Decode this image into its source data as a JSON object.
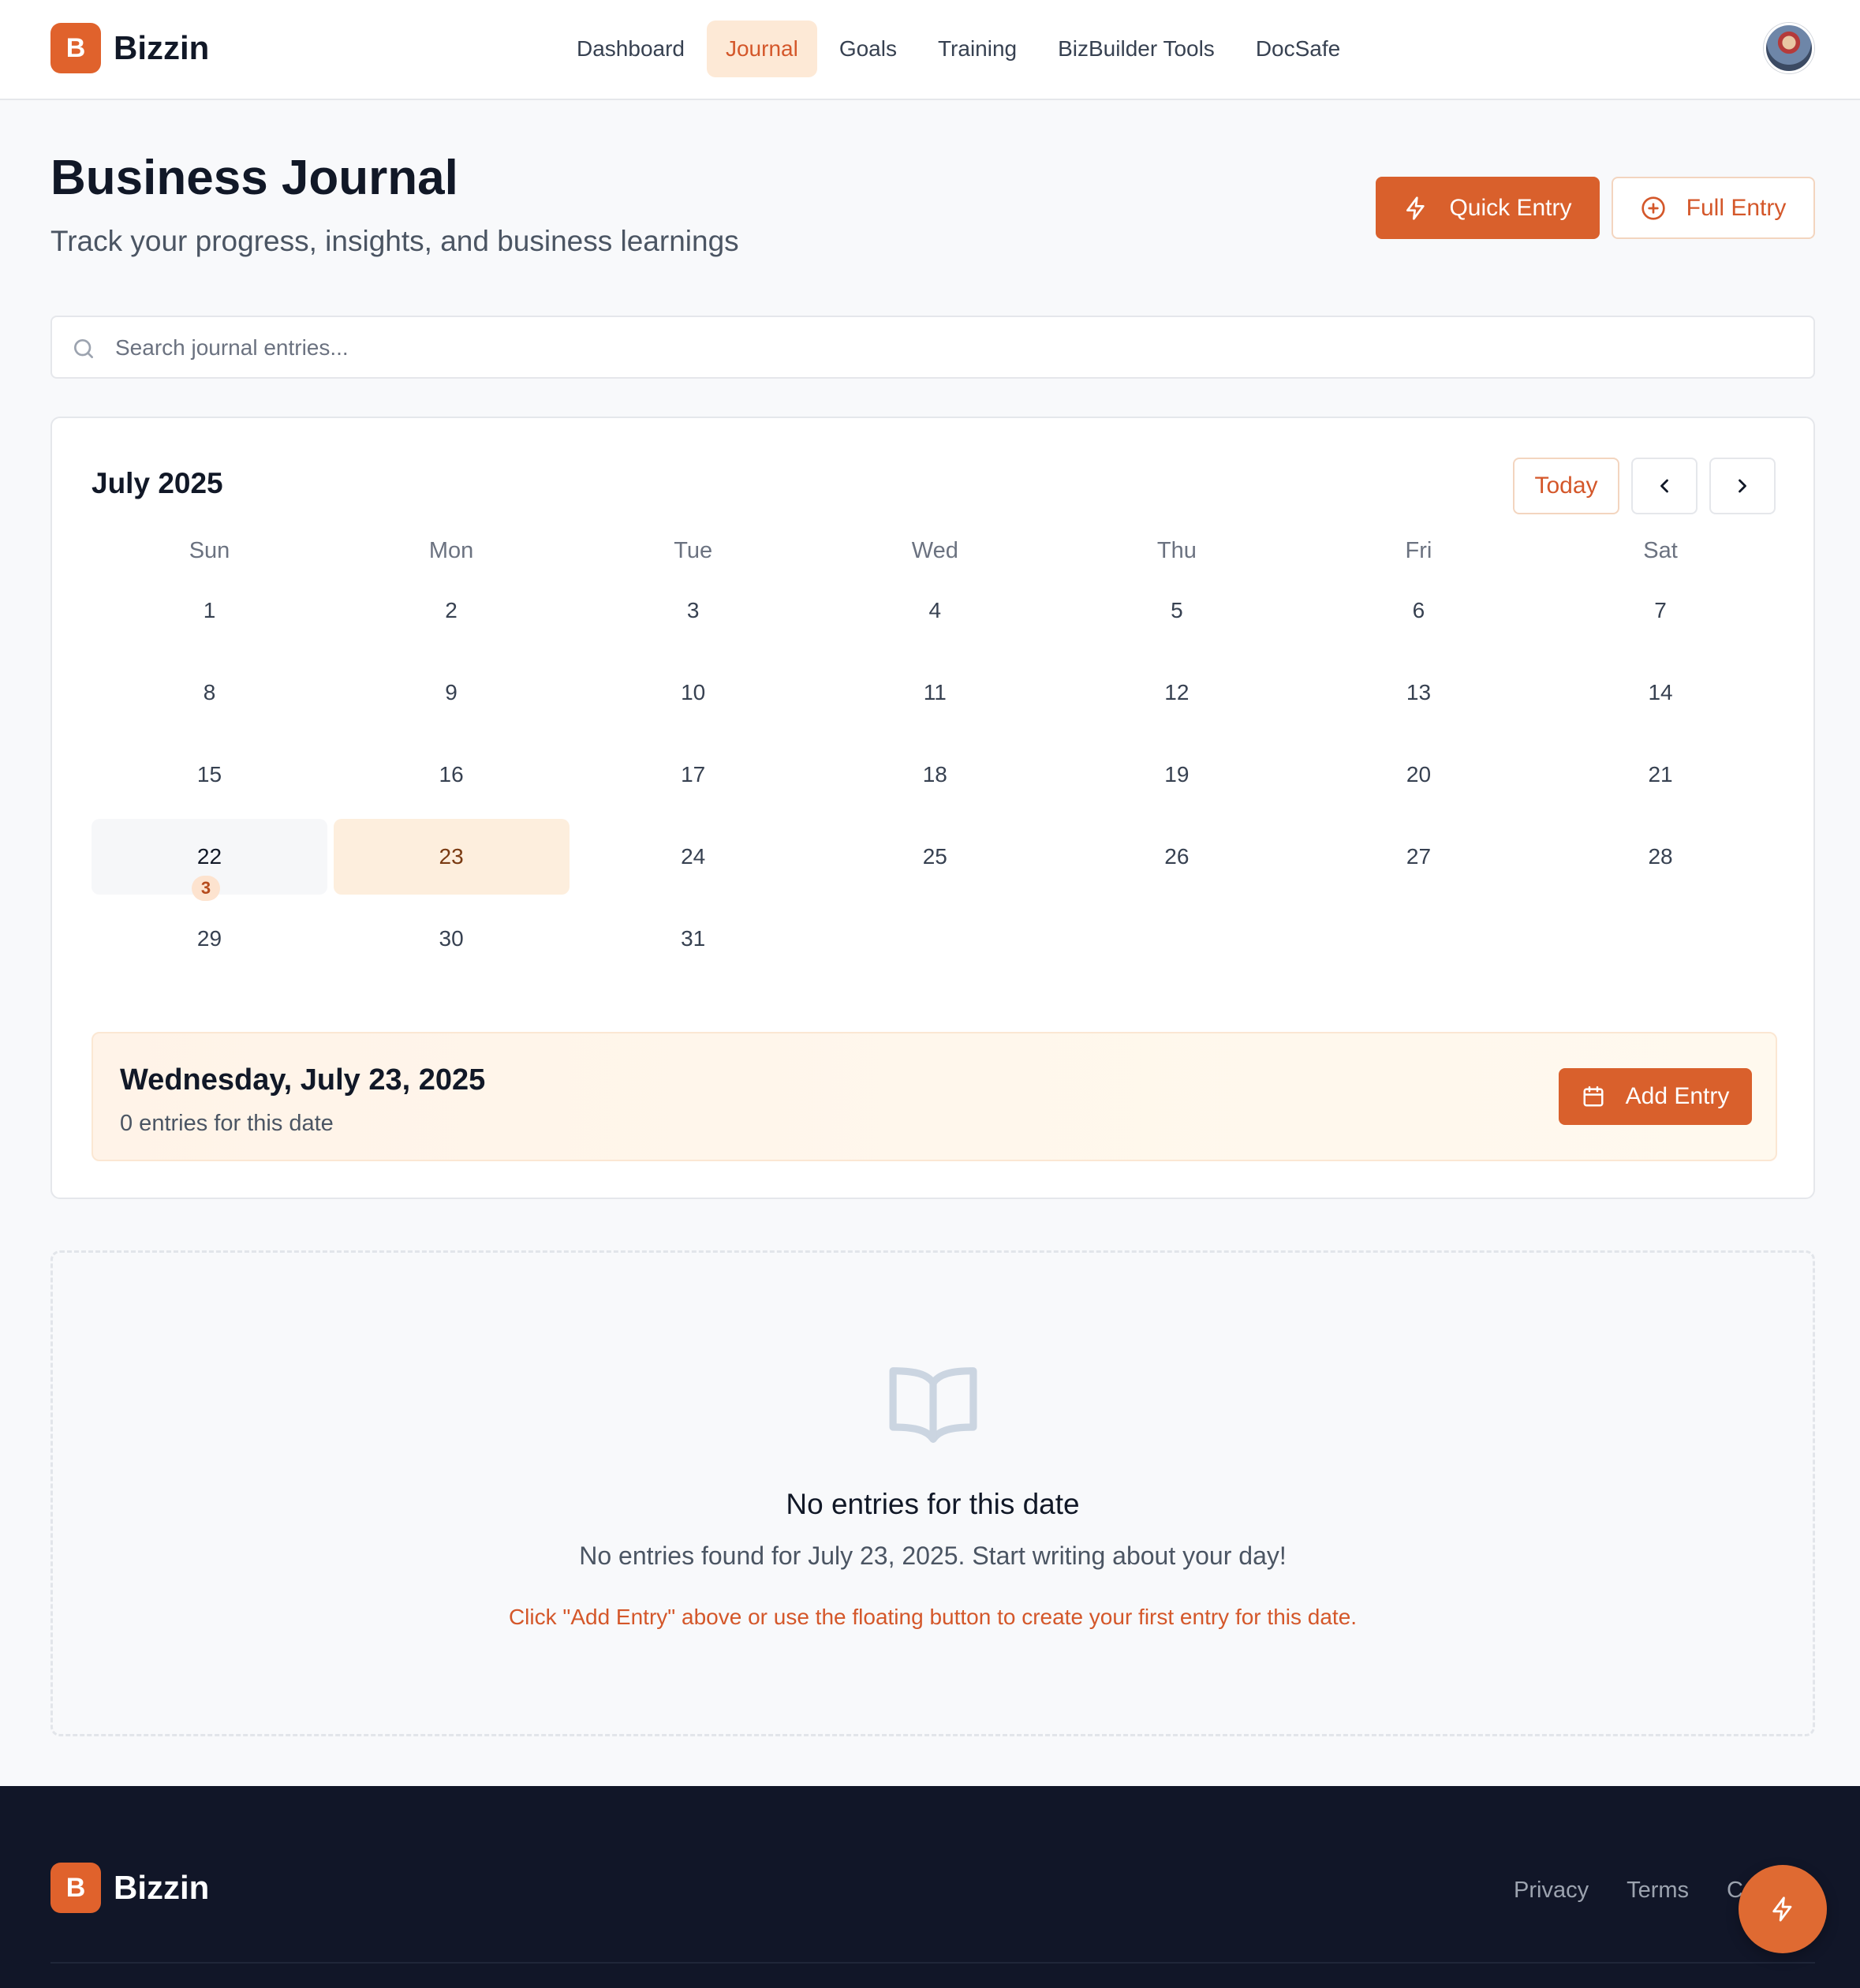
{
  "brand": {
    "logo_letter": "B",
    "name": "Bizzin",
    "accent": "#d9602c"
  },
  "nav": {
    "items": [
      {
        "label": "Dashboard"
      },
      {
        "label": "Journal",
        "active": true
      },
      {
        "label": "Goals"
      },
      {
        "label": "Training"
      },
      {
        "label": "BizBuilder Tools"
      },
      {
        "label": "DocSafe"
      }
    ]
  },
  "header": {
    "title": "Business Journal",
    "subtitle": "Track your progress, insights, and business learnings",
    "quick_entry_label": "Quick Entry",
    "full_entry_label": "Full Entry"
  },
  "search": {
    "placeholder": "Search journal entries...",
    "value": ""
  },
  "calendar": {
    "month_label": "July 2025",
    "today_label": "Today",
    "weekdays": [
      "Sun",
      "Mon",
      "Tue",
      "Wed",
      "Thu",
      "Fri",
      "Sat"
    ],
    "weeks": [
      [
        "1",
        "2",
        "3",
        "4",
        "5",
        "6",
        "7"
      ],
      [
        "8",
        "9",
        "10",
        "11",
        "12",
        "13",
        "14"
      ],
      [
        "15",
        "16",
        "17",
        "18",
        "19",
        "20",
        "21"
      ],
      [
        "22",
        "23",
        "24",
        "25",
        "26",
        "27",
        "28"
      ],
      [
        "29",
        "30",
        "31",
        "",
        "",
        "",
        ""
      ]
    ],
    "highlighted_day": "22",
    "highlighted_day_entry_count": "3",
    "selected_day": "23"
  },
  "selected_date": {
    "title": "Wednesday, July 23, 2025",
    "count_text": "0 entries for this date",
    "add_label": "Add Entry"
  },
  "empty_state": {
    "icon": "book-open-icon",
    "title": "No entries for this date",
    "text": "No entries found for July 23, 2025. Start writing about your day!",
    "hint": "Click \"Add Entry\" above or use the floating button to create your first entry for this date."
  },
  "footer": {
    "logo_letter": "B",
    "name": "Bizzin",
    "links": [
      "Privacy",
      "Terms",
      "C"
    ]
  }
}
